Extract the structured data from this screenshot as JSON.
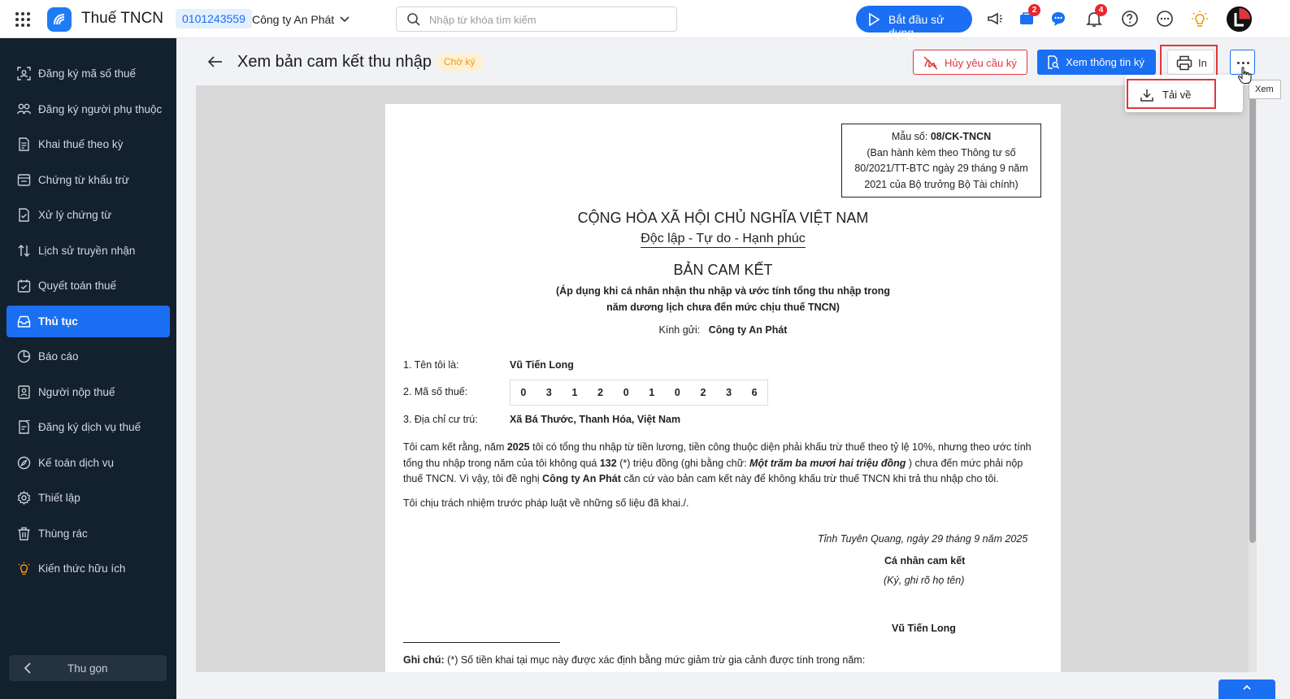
{
  "topbar": {
    "app_title": "Thuế TNCN",
    "tax_code": "0101243559",
    "company": "Công ty An Phát",
    "search_placeholder": "Nhập từ khóa tìm kiếm",
    "start_label": "Bắt đầu sử dụng",
    "cart_badge": "2",
    "notification_badge": "4"
  },
  "sidebar": {
    "items": [
      {
        "label": "Đăng ký mã số thuế",
        "icon": "id-scan-icon"
      },
      {
        "label": "Đăng ký người phụ thuộc",
        "icon": "people-icon"
      },
      {
        "label": "Khai thuế theo kỳ",
        "icon": "document-icon"
      },
      {
        "label": "Chứng từ khấu trừ",
        "icon": "receipt-icon"
      },
      {
        "label": "Xử lý chứng từ",
        "icon": "document-check-icon"
      },
      {
        "label": "Lịch sử truyền nhận",
        "icon": "arrows-updown-icon"
      },
      {
        "label": "Quyết toán thuế",
        "icon": "calendar-check-icon"
      },
      {
        "label": "Thủ tục",
        "icon": "inbox-icon",
        "active": true
      },
      {
        "label": "Báo cáo",
        "icon": "pie-chart-icon"
      },
      {
        "label": "Người nộp thuế",
        "icon": "person-document-icon"
      },
      {
        "label": "Đăng ký dịch vụ thuế",
        "icon": "document-edit-icon"
      },
      {
        "label": "Kế toán dịch vụ",
        "icon": "compass-icon"
      },
      {
        "label": "Thiết lập",
        "icon": "gear-icon"
      },
      {
        "label": "Thùng rác",
        "icon": "trash-icon"
      },
      {
        "label": "Kiến thức hữu ích",
        "icon": "lightbulb-icon"
      }
    ],
    "collapse_label": "Thu gọn"
  },
  "header": {
    "title": "Xem bản cam kết thu nhập",
    "status": "Chờ ký",
    "cancel_label": "Hủy yêu cầu ký",
    "info_label": "Xem thông tin ký",
    "print_label": "In",
    "tooltip": "Xem",
    "download_label": "Tải về"
  },
  "colors": {
    "primary": "#1b6ff2",
    "danger": "#e0363b",
    "sidebar_bg": "#13202e",
    "status_bg": "#fdf0d4",
    "status_fg": "#f29a16"
  },
  "document": {
    "form_code_prefix": "Mẫu số:",
    "form_code": "08/CK-TNCN",
    "form_note_1": "(Ban hành kèm theo Thông tư số",
    "form_note_2": "80/2021/TT-BTC ngày 29 tháng 9 năm",
    "form_note_3": "2021 của Bộ trưởng Bộ Tài chính)",
    "nation": "CỘNG HÒA XÃ HỘI CHỦ NGHĨA VIỆT NAM",
    "motto": "Độc lập - Tự do - Hạnh phúc",
    "title": "BẢN CAM KẾT",
    "subtitle_1": "(Áp dụng khi cá nhân nhận thu nhập và ước tính tổng thu nhập trong",
    "subtitle_2": "năm dương lịch chưa đến mức chịu thuế TNCN)",
    "recipient_label": "Kính gửi:",
    "recipient": "Công ty An Phát",
    "name_label": "1. Tên tôi là:",
    "name": "Vũ Tiến Long",
    "tax_label": "2. Mã số thuế:",
    "tax_digits": [
      "0",
      "3",
      "1",
      "2",
      "0",
      "1",
      "0",
      "2",
      "3",
      "6"
    ],
    "address_label": "3. Địa chỉ cư trú:",
    "address": "Xã Bá Thước, Thanh Hóa, Việt Nam",
    "commit_1a": "Tôi cam kết rằng, năm ",
    "commit_year": "2025",
    "commit_1b": " tôi có tổng thu nhập từ tiền lương, tiền công thuộc diện phải khấu trừ thuế theo tỷ lệ 10%, nhưng theo ước tính tổng thu nhập trong năm của tôi không quá ",
    "commit_amount": "132",
    "commit_1c": " (*) triệu đồng (ghi bằng chữ: ",
    "commit_words": "Một trăm ba mươi hai triệu đồng",
    "commit_1d": " ) chưa đến mức phải nộp thuế TNCN. Vì vậy, tôi đề nghị ",
    "commit_company": "Công ty An Phát",
    "commit_1e": " căn cứ vào bản cam kết này để không khấu trừ thuế TNCN khi trả thu nhập cho tôi.",
    "responsibility": "Tôi chịu trách nhiệm trước pháp luật về những số liệu đã khai./.",
    "place_date": "Tỉnh Tuyên Quang, ngày 29 tháng 9 năm 2025",
    "signer_title": "Cá nhân cam kết",
    "signer_note": "(Ký, ghi rõ họ tên)",
    "signer_name": "Vũ Tiến Long",
    "note_label": "Ghi chú:",
    "note_text": " (*) Số tiền khai tại mục này được xác định bằng mức giảm trừ gia cảnh được tính trong năm:"
  }
}
